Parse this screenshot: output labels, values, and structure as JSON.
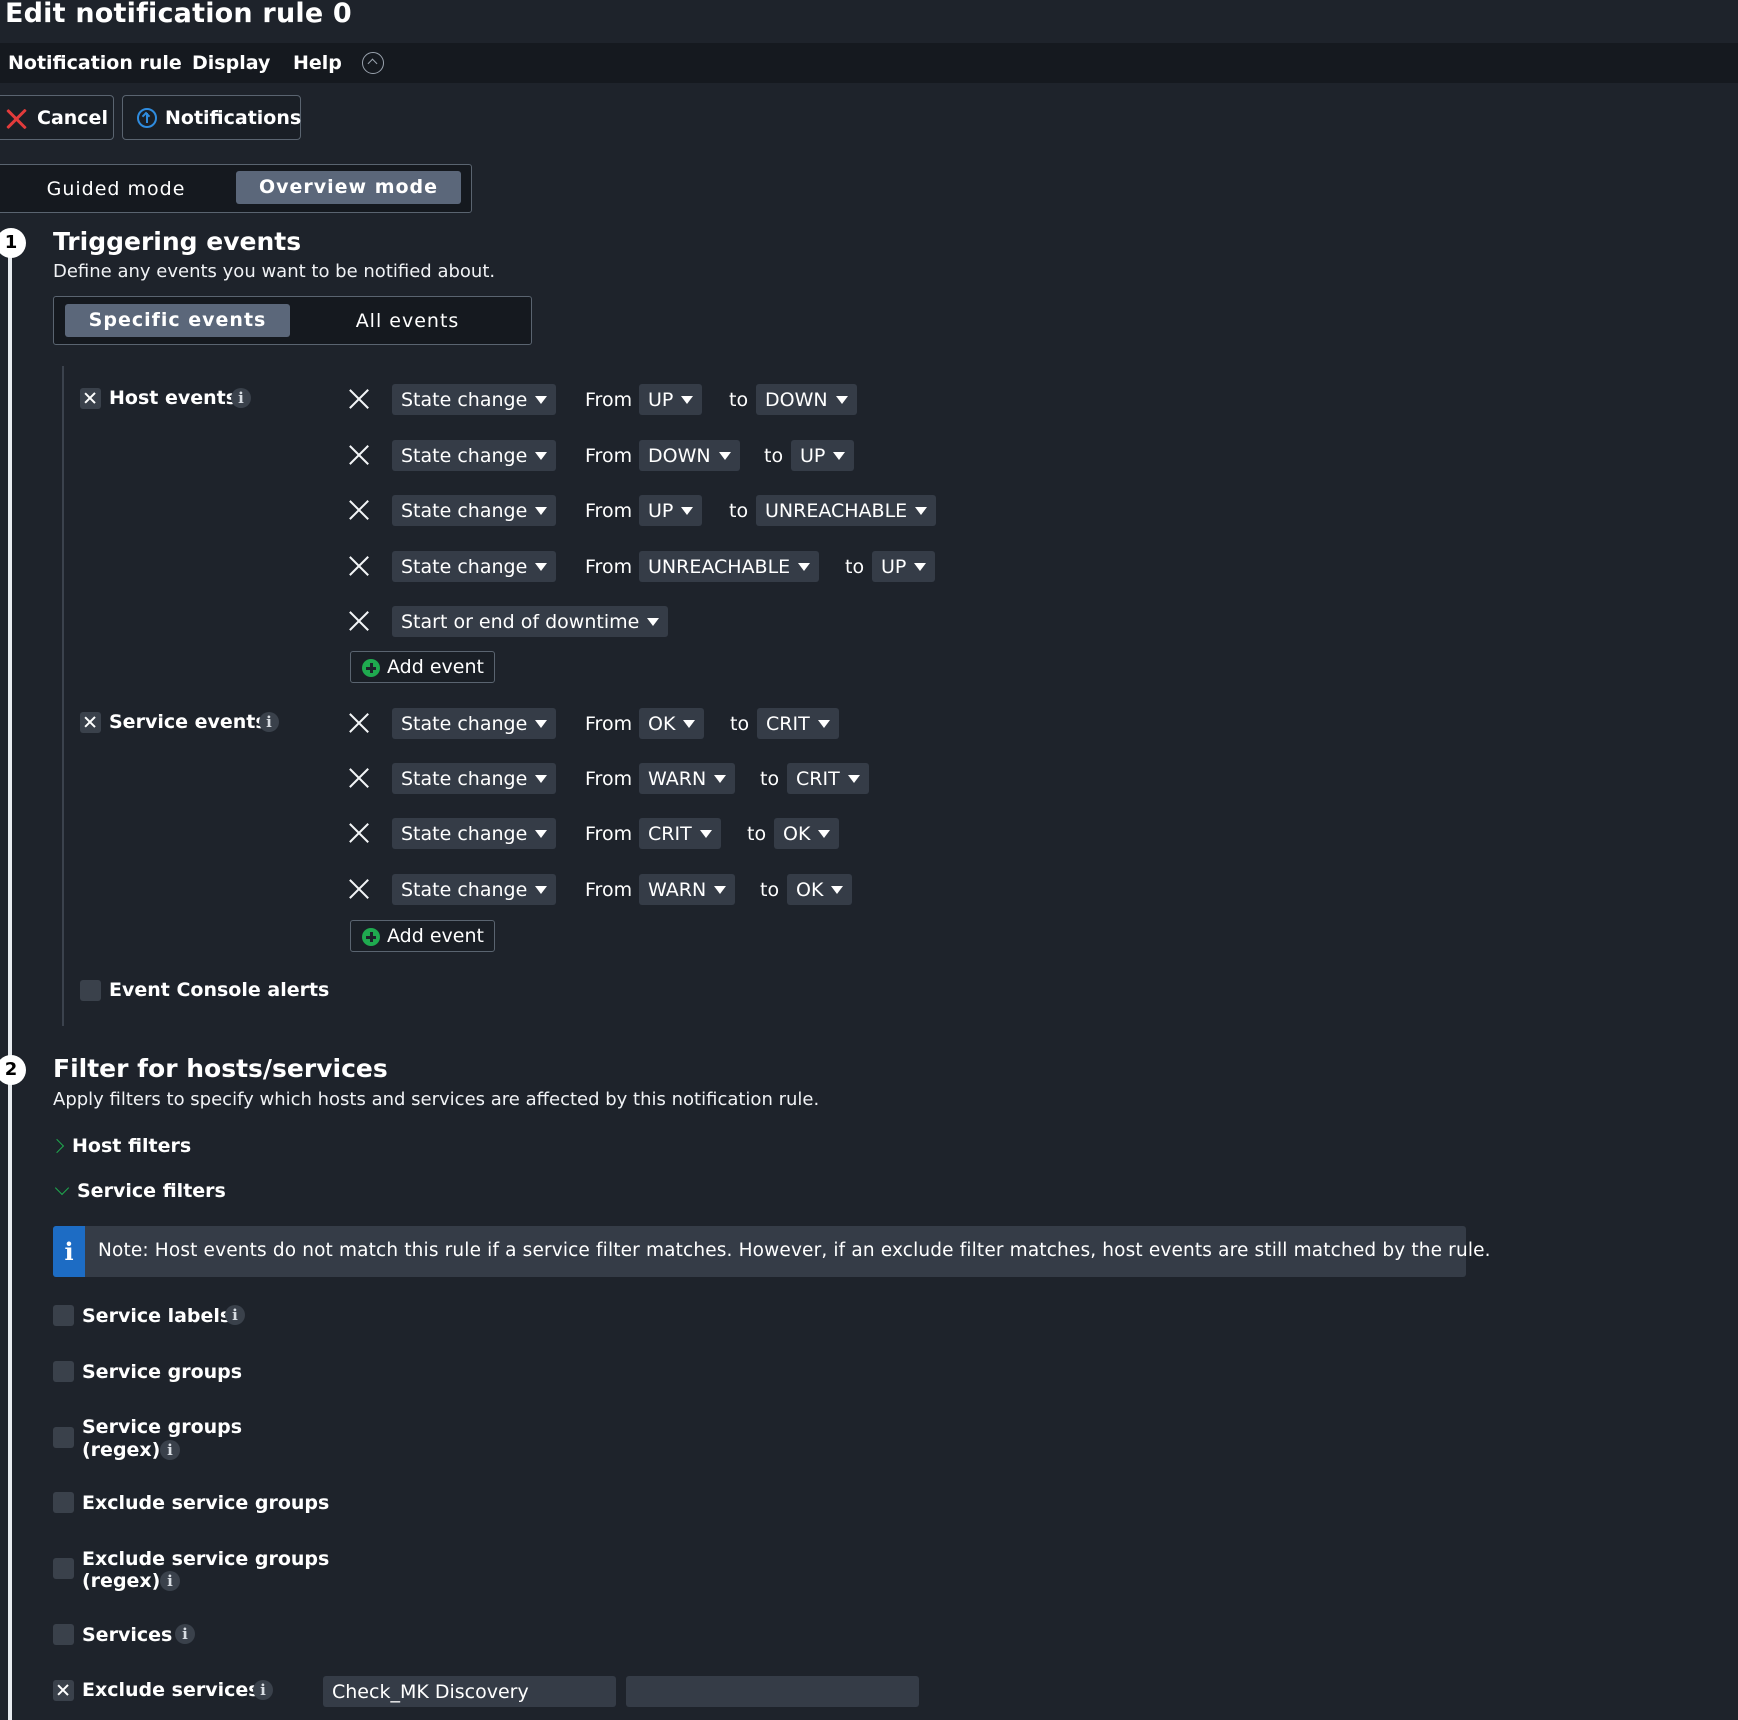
{
  "page": {
    "title": "Edit notification rule 0"
  },
  "menu": {
    "items": [
      "Notification rule",
      "Display",
      "Help"
    ]
  },
  "toolbar": {
    "cancel_label": "Cancel",
    "notifications_label": "Notifications"
  },
  "mode_toggle": {
    "options": [
      "Guided mode",
      "Overview mode"
    ],
    "selected": "Overview mode"
  },
  "step1": {
    "number": "1",
    "title": "Triggering events",
    "description": "Define any events you want to be notified about.",
    "event_toggle": {
      "options": [
        "Specific events",
        "All events"
      ],
      "selected": "Specific events"
    },
    "host_events": {
      "label": "Host events",
      "checked": true,
      "rows": [
        {
          "type": "State change",
          "from_label": "From",
          "from": "UP",
          "to_label": "to",
          "to": "DOWN"
        },
        {
          "type": "State change",
          "from_label": "From",
          "from": "DOWN",
          "to_label": "to",
          "to": "UP"
        },
        {
          "type": "State change",
          "from_label": "From",
          "from": "UP",
          "to_label": "to",
          "to": "UNREACHABLE"
        },
        {
          "type": "State change",
          "from_label": "From",
          "from": "UNREACHABLE",
          "to_label": "to",
          "to": "UP"
        },
        {
          "type": "Start or end of downtime"
        }
      ],
      "add_label": "Add event"
    },
    "service_events": {
      "label": "Service events",
      "checked": true,
      "rows": [
        {
          "type": "State change",
          "from_label": "From",
          "from": "OK",
          "to_label": "to",
          "to": "CRIT"
        },
        {
          "type": "State change",
          "from_label": "From",
          "from": "WARN",
          "to_label": "to",
          "to": "CRIT"
        },
        {
          "type": "State change",
          "from_label": "From",
          "from": "CRIT",
          "to_label": "to",
          "to": "OK"
        },
        {
          "type": "State change",
          "from_label": "From",
          "from": "WARN",
          "to_label": "to",
          "to": "OK"
        }
      ],
      "add_label": "Add event"
    },
    "ec_alerts": {
      "label": "Event Console alerts",
      "checked": false
    }
  },
  "step2": {
    "number": "2",
    "title": "Filter for hosts/services",
    "description": "Apply filters to specify which hosts and services are affected by this notification rule.",
    "host_filters": "Host filters",
    "service_filters": "Service filters",
    "note": "Note: Host events do not match this rule if a service filter matches. However, if an exclude filter matches, host events are still matched by the rule.",
    "filters": {
      "service_labels": "Service labels",
      "service_groups": "Service groups",
      "service_groups_regex_1": "Service groups",
      "service_groups_regex_2": "(regex)",
      "exclude_service_groups": "Exclude service groups",
      "exclude_service_groups_regex_1": "Exclude service groups",
      "exclude_service_groups_regex_2": "(regex)",
      "services": "Services",
      "exclude_services": "Exclude services"
    },
    "exclude_services_values": [
      "Check_MK Discovery",
      ""
    ]
  },
  "colors": {
    "background": "#1e232b",
    "accent_green": "#1faa4f",
    "accent_blue": "#1d6cc4",
    "cancel_red": "#e23b3b"
  }
}
